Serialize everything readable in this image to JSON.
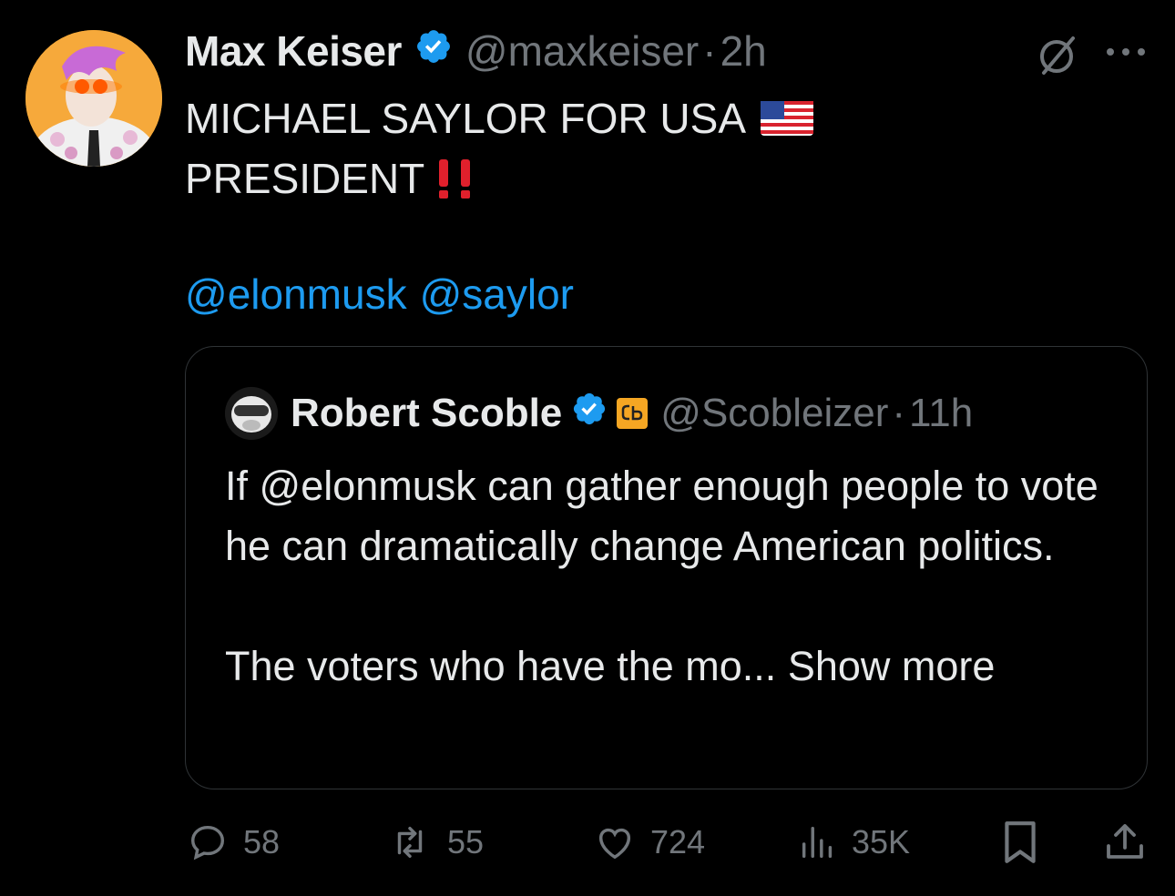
{
  "tweet": {
    "author_name": "Max Keiser",
    "handle": "@maxkeiser",
    "separator": "·",
    "time": "2h",
    "text_line1": "MICHAEL SAYLOR FOR USA",
    "text_line2": "PRESIDENT",
    "mentions": [
      "@elonmusk",
      "@saylor"
    ]
  },
  "quoted": {
    "author_name": "Robert Scoble",
    "handle": "@Scobleizer",
    "separator": "·",
    "time": "11h",
    "paragraph1": "If @elonmusk can gather enough people to vote he can dramatically change American politics.",
    "paragraph2_prefix": "The voters who have the mo...",
    "show_more": "Show more"
  },
  "actions": {
    "replies": "58",
    "reposts": "55",
    "likes": "724",
    "views": "35K"
  },
  "icons": {
    "verified": "verified-badge-icon",
    "flag": "us-flag-icon",
    "exclamation": "double-exclamation-icon",
    "grok": "grok-icon",
    "more": "more-icon",
    "reply": "reply-icon",
    "repost": "repost-icon",
    "like": "heart-icon",
    "views": "views-icon",
    "bookmark": "bookmark-icon",
    "share": "share-icon"
  },
  "colors": {
    "background": "#000000",
    "text": "#e7e9ea",
    "muted": "#71767b",
    "link": "#1d9bf0",
    "verified": "#1d9bf0",
    "border": "#2f3336"
  }
}
